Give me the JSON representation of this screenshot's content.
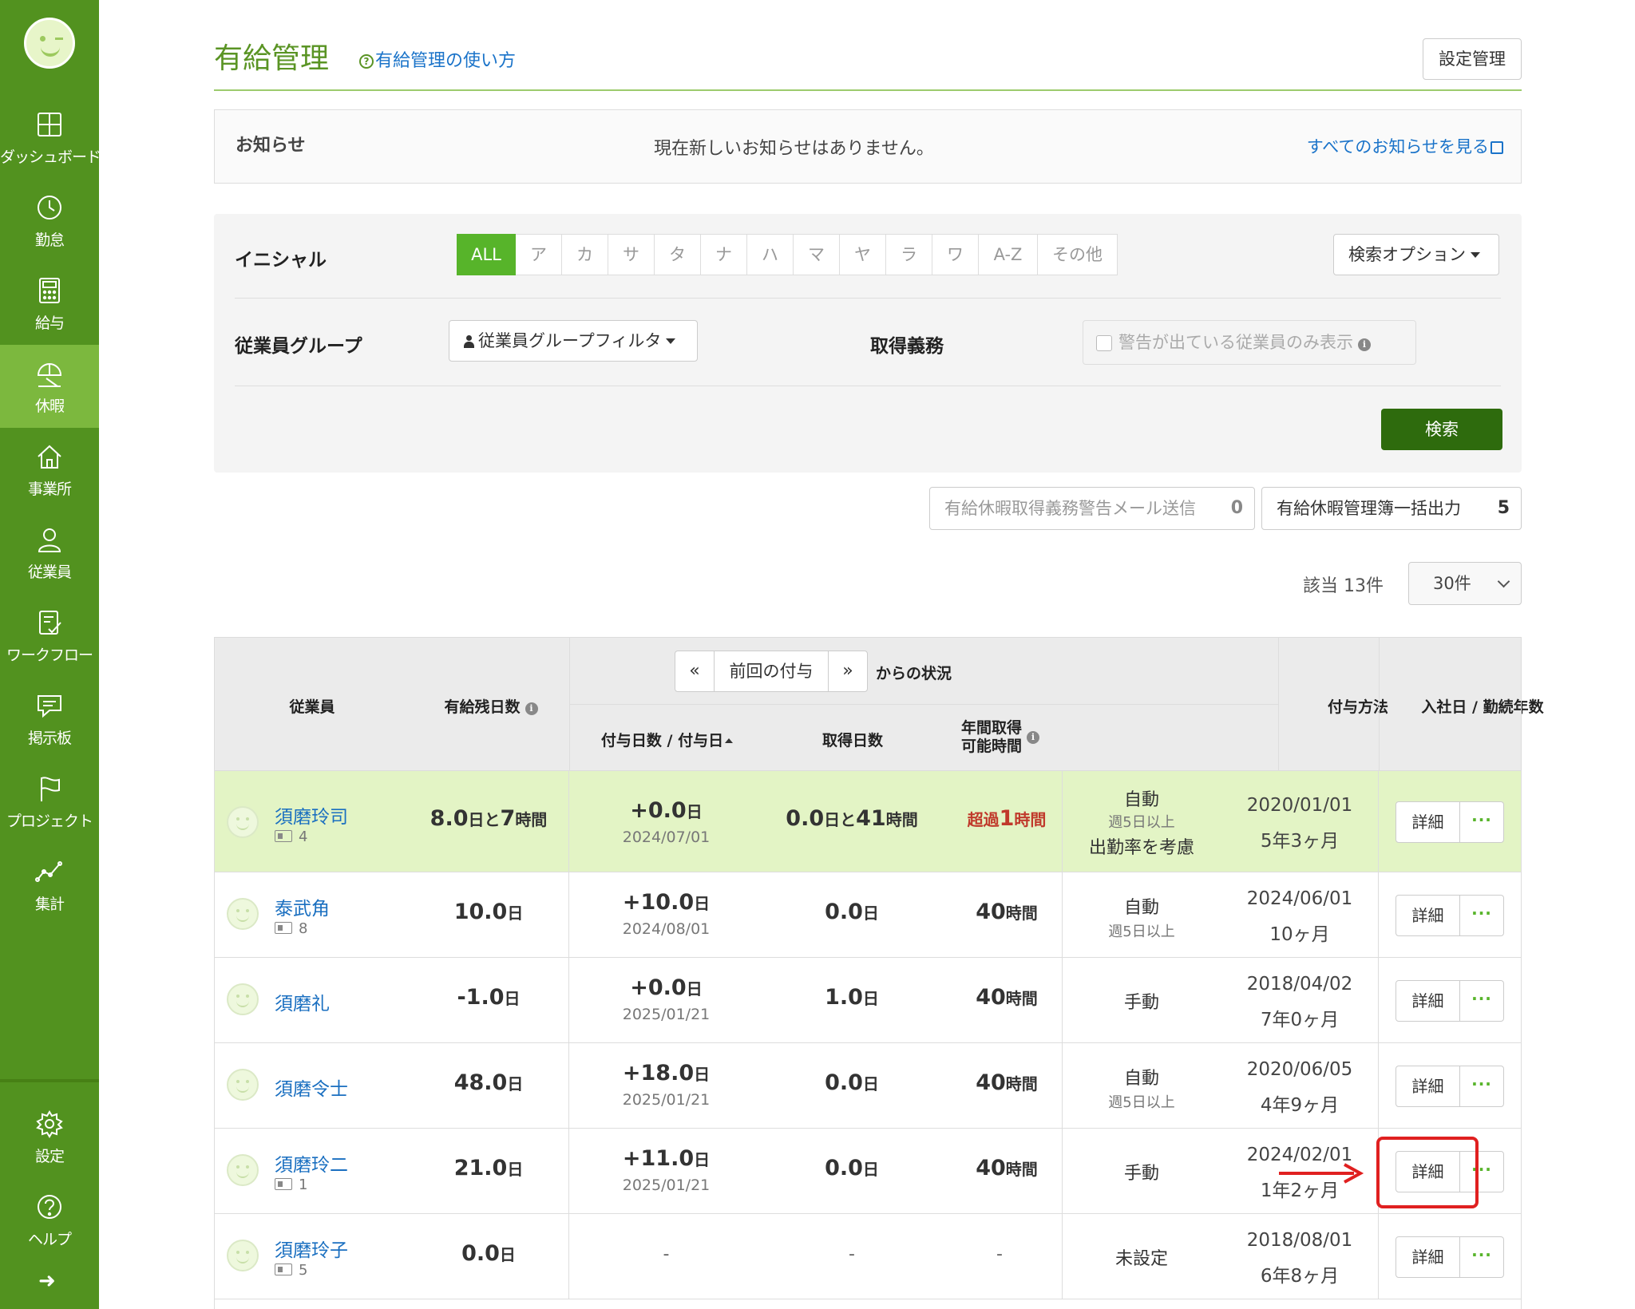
{
  "sidebar": {
    "items": [
      {
        "label": "ダッシュボード",
        "icon": "dashboard-icon"
      },
      {
        "label": "勤怠",
        "icon": "clock-icon"
      },
      {
        "label": "給与",
        "icon": "calculator-icon"
      },
      {
        "label": "休暇",
        "icon": "umbrella-icon",
        "active": true
      },
      {
        "label": "事業所",
        "icon": "home-icon"
      },
      {
        "label": "従業員",
        "icon": "person-icon"
      },
      {
        "label": "ワークフロー",
        "icon": "checklist-icon"
      },
      {
        "label": "掲示板",
        "icon": "message-icon"
      },
      {
        "label": "プロジェクト",
        "icon": "flag-icon"
      },
      {
        "label": "集計",
        "icon": "chart-line-icon"
      }
    ],
    "bottom": [
      {
        "label": "設定",
        "icon": "gear-icon"
      },
      {
        "label": "ヘルプ",
        "icon": "help-icon"
      }
    ],
    "collapse_glyph": "➜"
  },
  "header": {
    "title": "有給管理",
    "help_link": "有給管理の使い方",
    "settings_button": "設定管理"
  },
  "notice": {
    "label": "お知らせ",
    "message": "現在新しいお知らせはありません。",
    "see_all": "すべてのお知らせを見る"
  },
  "filter": {
    "initial_label": "イニシャル",
    "initials": [
      "ALL",
      "ア",
      "カ",
      "サ",
      "タ",
      "ナ",
      "ハ",
      "マ",
      "ヤ",
      "ラ",
      "ワ",
      "A-Z",
      "その他"
    ],
    "active_initial": "ALL",
    "search_option": "検索オプション",
    "group_label": "従業員グループ",
    "group_filter": "従業員グループフィルタ",
    "obligation_label": "取得義務",
    "warn_only": "警告が出ている従業員のみ表示",
    "search_button": "検索"
  },
  "actions": {
    "warn_mail": {
      "label": "有給休暇取得義務警告メール送信",
      "count": "0"
    },
    "ledger": {
      "label": "有給休暇管理簿一括出力",
      "count": "5"
    }
  },
  "result": {
    "count_label": "該当 13件",
    "per_page": "30件"
  },
  "table": {
    "headers": {
      "employee": "従業員",
      "remaining": "有給残日数",
      "prev_nav_left": "«",
      "prev_nav_mid": "前回の付与",
      "prev_nav_right": "»",
      "status_suffix": "からの状況",
      "grant": "付与日数 / 付与日",
      "taken": "取得日数",
      "annual_line1": "年間取得",
      "annual_line2": "可能時間",
      "method": "付与方法",
      "hire": "入社日 / 勤続年数"
    },
    "detail_label": "詳細",
    "more_label": "···",
    "rows": [
      {
        "name": "須磨玲司",
        "id": "4",
        "remaining_num": "8.0",
        "remaining_unit": "日と",
        "remaining_num2": "7",
        "remaining_unit2": "時間",
        "grant_num": "+0.0",
        "grant_unit": "日",
        "grant_date": "2024/07/01",
        "taken_num": "0.0",
        "taken_unit": "日と",
        "taken_num2": "41",
        "taken_unit2": "時間",
        "annual_prefix": "超過",
        "annual_num": "1",
        "annual_unit": "時間",
        "method": "自動",
        "method_sub": "週5日以上",
        "method_sub2": "出勤率を考慮",
        "hire_date": "2020/01/01",
        "tenure": "5年3ヶ月"
      },
      {
        "name": "泰武角",
        "id": "8",
        "remaining_num": "10.0",
        "remaining_unit": "日",
        "grant_num": "+10.0",
        "grant_unit": "日",
        "grant_date": "2024/08/01",
        "taken_num": "0.0",
        "taken_unit": "日",
        "annual_num": "40",
        "annual_unit": "時間",
        "method": "自動",
        "method_sub": "週5日以上",
        "hire_date": "2024/06/01",
        "tenure": "10ヶ月"
      },
      {
        "name": "須磨礼",
        "id": "",
        "remaining_num": "-1.0",
        "remaining_unit": "日",
        "grant_num": "+0.0",
        "grant_unit": "日",
        "grant_date": "2025/01/21",
        "taken_num": "1.0",
        "taken_unit": "日",
        "annual_num": "40",
        "annual_unit": "時間",
        "method": "手動",
        "hire_date": "2018/04/02",
        "tenure": "7年0ヶ月"
      },
      {
        "name": "須磨令士",
        "id": "",
        "remaining_num": "48.0",
        "remaining_unit": "日",
        "grant_num": "+18.0",
        "grant_unit": "日",
        "grant_date": "2025/01/21",
        "taken_num": "0.0",
        "taken_unit": "日",
        "annual_num": "40",
        "annual_unit": "時間",
        "method": "自動",
        "method_sub": "週5日以上",
        "hire_date": "2020/06/05",
        "tenure": "4年9ヶ月"
      },
      {
        "name": "須磨玲二",
        "id": "1",
        "remaining_num": "21.0",
        "remaining_unit": "日",
        "grant_num": "+11.0",
        "grant_unit": "日",
        "grant_date": "2025/01/21",
        "taken_num": "0.0",
        "taken_unit": "日",
        "annual_num": "40",
        "annual_unit": "時間",
        "method": "手動",
        "hire_date": "2024/02/01",
        "tenure": "1年2ヶ月"
      },
      {
        "name": "須磨玲子",
        "id": "5",
        "remaining_num": "0.0",
        "remaining_unit": "日",
        "grant_dash": "-",
        "taken_dash": "-",
        "annual_dash": "-",
        "method_red": "未設定",
        "hire_date": "2018/08/01",
        "tenure": "6年8ヶ月"
      }
    ]
  },
  "colors": {
    "sidebar": "#52921f",
    "sidebar_active": "#7cb83e",
    "accent": "#57b42a",
    "search_button": "#2e6b0d",
    "link": "#1a73c9",
    "highlight_row": "#e3f4c5",
    "warning_red": "#c0392b",
    "annotation_red": "#e02020"
  }
}
